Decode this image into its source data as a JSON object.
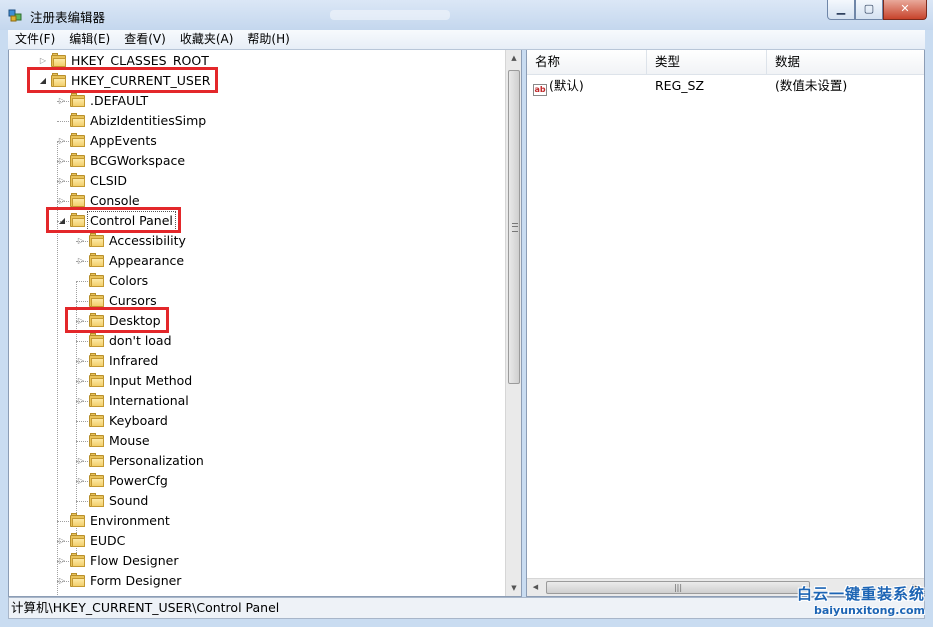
{
  "window": {
    "title": "注册表编辑器",
    "buttons": {
      "minimize": "▁",
      "maximize": "▢",
      "close": "✕"
    }
  },
  "menu": [
    {
      "label": "文件(F)"
    },
    {
      "label": "编辑(E)"
    },
    {
      "label": "查看(V)"
    },
    {
      "label": "收藏夹(A)"
    },
    {
      "label": "帮助(H)"
    }
  ],
  "tree": {
    "items": [
      {
        "label": "HKEY_CLASSES_ROOT",
        "level": 0,
        "expander": "collapsed"
      },
      {
        "label": "HKEY_CURRENT_USER",
        "level": 0,
        "expander": "expanded",
        "highlighted": true
      },
      {
        "label": ".DEFAULT",
        "level": 1,
        "expander": "collapsed"
      },
      {
        "label": "AbizIdentitiesSimp",
        "level": 1,
        "expander": "none"
      },
      {
        "label": "AppEvents",
        "level": 1,
        "expander": "collapsed"
      },
      {
        "label": "BCGWorkspace",
        "level": 1,
        "expander": "collapsed"
      },
      {
        "label": "CLSID",
        "level": 1,
        "expander": "collapsed"
      },
      {
        "label": "Console",
        "level": 1,
        "expander": "collapsed"
      },
      {
        "label": "Control Panel",
        "level": 1,
        "expander": "expanded",
        "highlighted": true,
        "selected": true
      },
      {
        "label": "Accessibility",
        "level": 2,
        "expander": "collapsed"
      },
      {
        "label": "Appearance",
        "level": 2,
        "expander": "collapsed"
      },
      {
        "label": "Colors",
        "level": 2,
        "expander": "none"
      },
      {
        "label": "Cursors",
        "level": 2,
        "expander": "none"
      },
      {
        "label": "Desktop",
        "level": 2,
        "expander": "collapsed",
        "highlighted": true
      },
      {
        "label": "don't load",
        "level": 2,
        "expander": "none"
      },
      {
        "label": "Infrared",
        "level": 2,
        "expander": "collapsed"
      },
      {
        "label": "Input Method",
        "level": 2,
        "expander": "collapsed"
      },
      {
        "label": "International",
        "level": 2,
        "expander": "collapsed"
      },
      {
        "label": "Keyboard",
        "level": 2,
        "expander": "none"
      },
      {
        "label": "Mouse",
        "level": 2,
        "expander": "none"
      },
      {
        "label": "Personalization",
        "level": 2,
        "expander": "collapsed"
      },
      {
        "label": "PowerCfg",
        "level": 2,
        "expander": "collapsed"
      },
      {
        "label": "Sound",
        "level": 2,
        "expander": "none"
      },
      {
        "label": "Environment",
        "level": 1,
        "expander": "none"
      },
      {
        "label": "EUDC",
        "level": 1,
        "expander": "collapsed"
      },
      {
        "label": "Flow Designer",
        "level": 1,
        "expander": "collapsed"
      },
      {
        "label": "Form Designer",
        "level": 1,
        "expander": "collapsed"
      }
    ]
  },
  "values_table": {
    "columns": [
      "名称",
      "类型",
      "数据"
    ],
    "rows": [
      {
        "icon": "string-value-icon",
        "icon_text": "ab",
        "name": "(默认)",
        "type": "REG_SZ",
        "data": "(数值未设置)"
      }
    ]
  },
  "status": {
    "path": "计算机\\HKEY_CURRENT_USER\\Control Panel"
  },
  "watermark": {
    "cn": "白云一键重装系统",
    "url": "baiyunxitong.com"
  },
  "colors": {
    "highlight_box": "#e3272a",
    "folder": "#f2cf6b"
  }
}
